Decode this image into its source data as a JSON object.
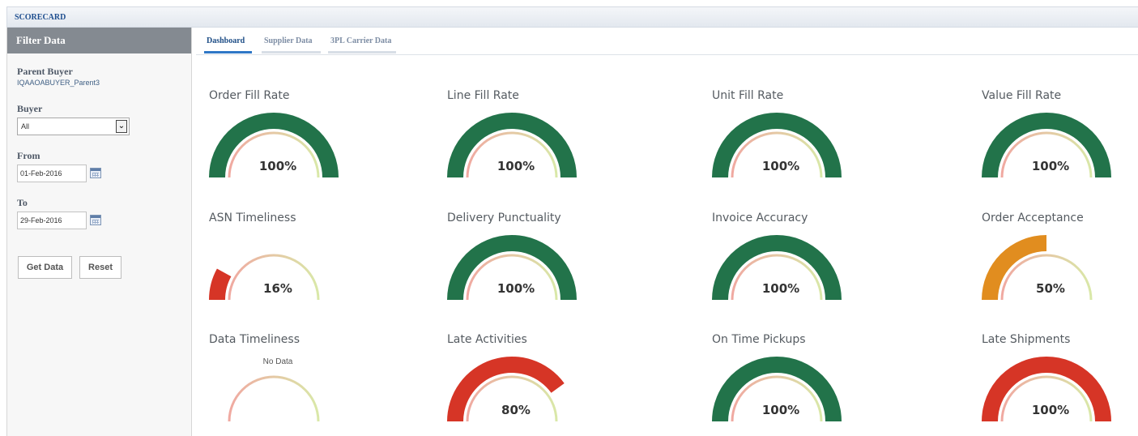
{
  "window": {
    "title": "SCORECARD"
  },
  "sidebar": {
    "header": "Filter Data",
    "parent_buyer": {
      "label": "Parent Buyer",
      "value": "IQAAOABUYER_Parent3"
    },
    "buyer": {
      "label": "Buyer",
      "selected": "All"
    },
    "from": {
      "label": "From",
      "value": "01-Feb-2016"
    },
    "to": {
      "label": "To",
      "value": "29-Feb-2016"
    },
    "get_data_label": "Get Data",
    "reset_label": "Reset"
  },
  "tabs": [
    {
      "label": "Dashboard",
      "active": true
    },
    {
      "label": "Supplier Data",
      "active": false
    },
    {
      "label": "3PL Carrier Data",
      "active": false
    }
  ],
  "colors": {
    "good": "#22734a",
    "warning": "#e18d1f",
    "bad": "#d63526",
    "track_low": "#f0a9a1",
    "track_high": "#d9e8a8"
  },
  "gauges": [
    {
      "title": "Order Fill Rate",
      "value_text": "100%",
      "value": 100,
      "status": "good"
    },
    {
      "title": "Line Fill Rate",
      "value_text": "100%",
      "value": 100,
      "status": "good"
    },
    {
      "title": "Unit Fill Rate",
      "value_text": "100%",
      "value": 100,
      "status": "good"
    },
    {
      "title": "Value Fill Rate",
      "value_text": "100%",
      "value": 100,
      "status": "good"
    },
    {
      "title": "ASN Timeliness",
      "value_text": "16%",
      "value": 16,
      "status": "bad"
    },
    {
      "title": "Delivery Punctuality",
      "value_text": "100%",
      "value": 100,
      "status": "good"
    },
    {
      "title": "Invoice Accuracy",
      "value_text": "100%",
      "value": 100,
      "status": "good"
    },
    {
      "title": "Order Acceptance",
      "value_text": "50%",
      "value": 50,
      "status": "warning"
    },
    {
      "title": "Data Timeliness",
      "value_text": "No Data",
      "value": null,
      "status": "none"
    },
    {
      "title": "Late Activities",
      "value_text": "80%",
      "value": 80,
      "status": "bad"
    },
    {
      "title": "On Time Pickups",
      "value_text": "100%",
      "value": 100,
      "status": "good"
    },
    {
      "title": "Late Shipments",
      "value_text": "100%",
      "value": 100,
      "status": "bad"
    }
  ]
}
